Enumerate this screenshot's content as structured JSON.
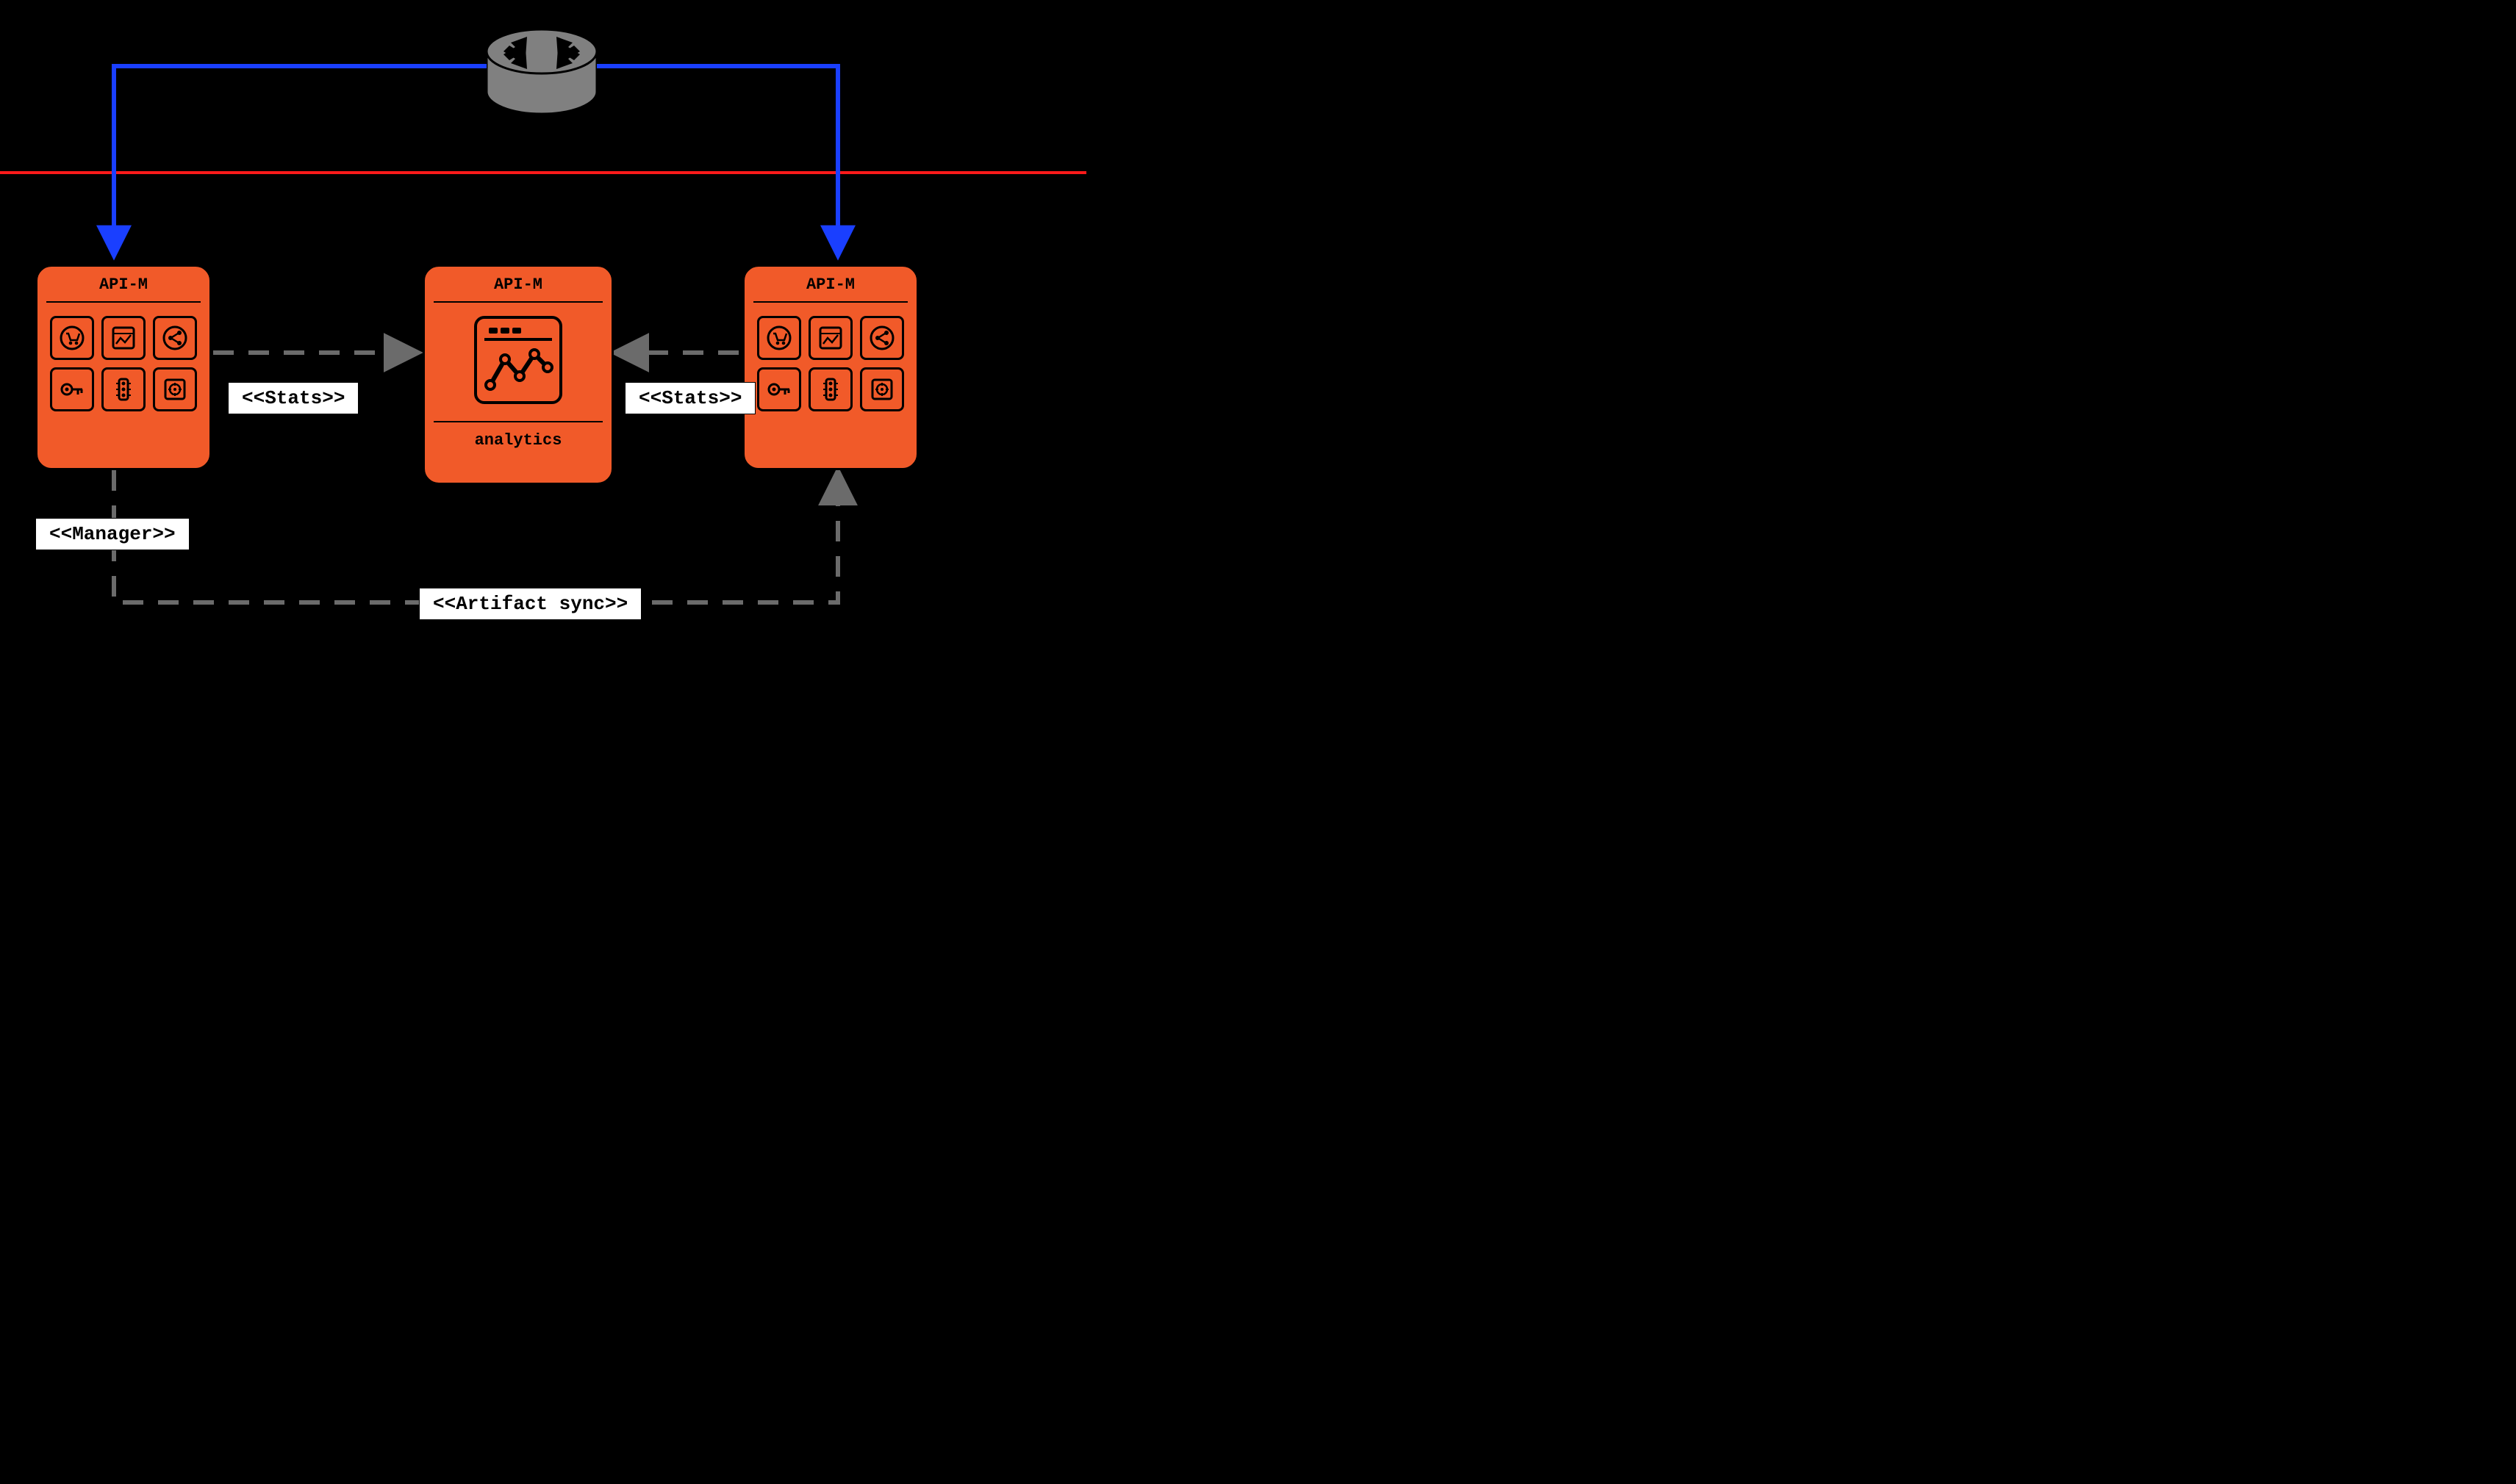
{
  "nodes": {
    "left": {
      "title": "API-M"
    },
    "center": {
      "title": "API-M",
      "sub": "analytics"
    },
    "right": {
      "title": "API-M"
    }
  },
  "labels": {
    "stats_left": "<<Stats>>",
    "stats_right": "<<Stats>>",
    "manager": "<<Manager>>",
    "artifact": "<<Artifact sync>>"
  },
  "icons": {
    "grid": [
      "cart-icon",
      "chart-icon",
      "share-icon",
      "key-icon",
      "traffic-icon",
      "safe-icon"
    ]
  },
  "colors": {
    "node_fill": "#f15a29",
    "router_fill": "#808080",
    "blue_line": "#1a3fff",
    "red_line": "#ff1a1a",
    "dash_line": "#6b6b6b"
  }
}
